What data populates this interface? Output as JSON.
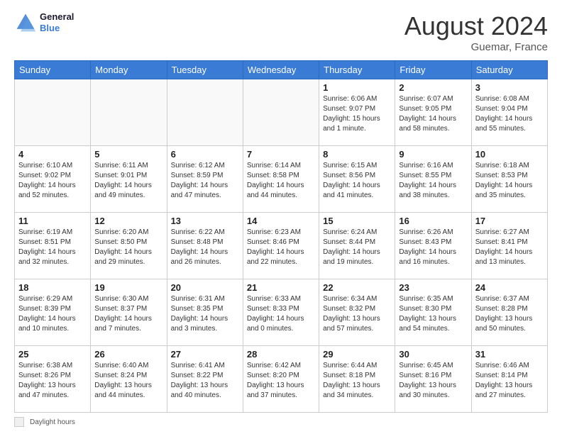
{
  "header": {
    "logo_general": "General",
    "logo_blue": "Blue",
    "month_title": "August 2024",
    "location": "Guemar, France"
  },
  "footer": {
    "label": "Daylight hours"
  },
  "days_of_week": [
    "Sunday",
    "Monday",
    "Tuesday",
    "Wednesday",
    "Thursday",
    "Friday",
    "Saturday"
  ],
  "weeks": [
    [
      {
        "day": "",
        "info": ""
      },
      {
        "day": "",
        "info": ""
      },
      {
        "day": "",
        "info": ""
      },
      {
        "day": "",
        "info": ""
      },
      {
        "day": "1",
        "info": "Sunrise: 6:06 AM\nSunset: 9:07 PM\nDaylight: 15 hours\nand 1 minute."
      },
      {
        "day": "2",
        "info": "Sunrise: 6:07 AM\nSunset: 9:05 PM\nDaylight: 14 hours\nand 58 minutes."
      },
      {
        "day": "3",
        "info": "Sunrise: 6:08 AM\nSunset: 9:04 PM\nDaylight: 14 hours\nand 55 minutes."
      }
    ],
    [
      {
        "day": "4",
        "info": "Sunrise: 6:10 AM\nSunset: 9:02 PM\nDaylight: 14 hours\nand 52 minutes."
      },
      {
        "day": "5",
        "info": "Sunrise: 6:11 AM\nSunset: 9:01 PM\nDaylight: 14 hours\nand 49 minutes."
      },
      {
        "day": "6",
        "info": "Sunrise: 6:12 AM\nSunset: 8:59 PM\nDaylight: 14 hours\nand 47 minutes."
      },
      {
        "day": "7",
        "info": "Sunrise: 6:14 AM\nSunset: 8:58 PM\nDaylight: 14 hours\nand 44 minutes."
      },
      {
        "day": "8",
        "info": "Sunrise: 6:15 AM\nSunset: 8:56 PM\nDaylight: 14 hours\nand 41 minutes."
      },
      {
        "day": "9",
        "info": "Sunrise: 6:16 AM\nSunset: 8:55 PM\nDaylight: 14 hours\nand 38 minutes."
      },
      {
        "day": "10",
        "info": "Sunrise: 6:18 AM\nSunset: 8:53 PM\nDaylight: 14 hours\nand 35 minutes."
      }
    ],
    [
      {
        "day": "11",
        "info": "Sunrise: 6:19 AM\nSunset: 8:51 PM\nDaylight: 14 hours\nand 32 minutes."
      },
      {
        "day": "12",
        "info": "Sunrise: 6:20 AM\nSunset: 8:50 PM\nDaylight: 14 hours\nand 29 minutes."
      },
      {
        "day": "13",
        "info": "Sunrise: 6:22 AM\nSunset: 8:48 PM\nDaylight: 14 hours\nand 26 minutes."
      },
      {
        "day": "14",
        "info": "Sunrise: 6:23 AM\nSunset: 8:46 PM\nDaylight: 14 hours\nand 22 minutes."
      },
      {
        "day": "15",
        "info": "Sunrise: 6:24 AM\nSunset: 8:44 PM\nDaylight: 14 hours\nand 19 minutes."
      },
      {
        "day": "16",
        "info": "Sunrise: 6:26 AM\nSunset: 8:43 PM\nDaylight: 14 hours\nand 16 minutes."
      },
      {
        "day": "17",
        "info": "Sunrise: 6:27 AM\nSunset: 8:41 PM\nDaylight: 14 hours\nand 13 minutes."
      }
    ],
    [
      {
        "day": "18",
        "info": "Sunrise: 6:29 AM\nSunset: 8:39 PM\nDaylight: 14 hours\nand 10 minutes."
      },
      {
        "day": "19",
        "info": "Sunrise: 6:30 AM\nSunset: 8:37 PM\nDaylight: 14 hours\nand 7 minutes."
      },
      {
        "day": "20",
        "info": "Sunrise: 6:31 AM\nSunset: 8:35 PM\nDaylight: 14 hours\nand 3 minutes."
      },
      {
        "day": "21",
        "info": "Sunrise: 6:33 AM\nSunset: 8:33 PM\nDaylight: 14 hours\nand 0 minutes."
      },
      {
        "day": "22",
        "info": "Sunrise: 6:34 AM\nSunset: 8:32 PM\nDaylight: 13 hours\nand 57 minutes."
      },
      {
        "day": "23",
        "info": "Sunrise: 6:35 AM\nSunset: 8:30 PM\nDaylight: 13 hours\nand 54 minutes."
      },
      {
        "day": "24",
        "info": "Sunrise: 6:37 AM\nSunset: 8:28 PM\nDaylight: 13 hours\nand 50 minutes."
      }
    ],
    [
      {
        "day": "25",
        "info": "Sunrise: 6:38 AM\nSunset: 8:26 PM\nDaylight: 13 hours\nand 47 minutes."
      },
      {
        "day": "26",
        "info": "Sunrise: 6:40 AM\nSunset: 8:24 PM\nDaylight: 13 hours\nand 44 minutes."
      },
      {
        "day": "27",
        "info": "Sunrise: 6:41 AM\nSunset: 8:22 PM\nDaylight: 13 hours\nand 40 minutes."
      },
      {
        "day": "28",
        "info": "Sunrise: 6:42 AM\nSunset: 8:20 PM\nDaylight: 13 hours\nand 37 minutes."
      },
      {
        "day": "29",
        "info": "Sunrise: 6:44 AM\nSunset: 8:18 PM\nDaylight: 13 hours\nand 34 minutes."
      },
      {
        "day": "30",
        "info": "Sunrise: 6:45 AM\nSunset: 8:16 PM\nDaylight: 13 hours\nand 30 minutes."
      },
      {
        "day": "31",
        "info": "Sunrise: 6:46 AM\nSunset: 8:14 PM\nDaylight: 13 hours\nand 27 minutes."
      }
    ]
  ]
}
